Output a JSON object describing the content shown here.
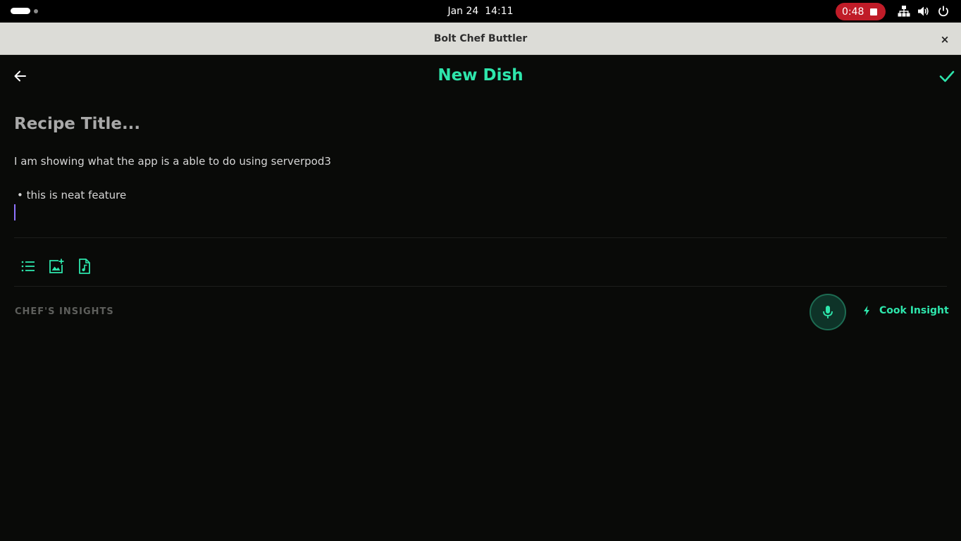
{
  "system_bar": {
    "date": "Jan 24",
    "time": "14:11",
    "recording_time": "0:48"
  },
  "window": {
    "title": "Bolt Chef Buttler",
    "close_glyph": "×"
  },
  "header": {
    "title": "New Dish"
  },
  "editor": {
    "title_placeholder": "Recipe Title...",
    "line1": "I am showing what the app is a able to do using serverpod3",
    "bullet_line": "• this is neat feature"
  },
  "toolbar": {
    "icons": [
      "bulleted-list-icon",
      "add-image-icon",
      "audio-file-icon"
    ]
  },
  "insights": {
    "section_label": "CHEF'S INSIGHTS",
    "cook_insight_label": "Cook Insight"
  },
  "colors": {
    "accent": "#2ee6ac",
    "background": "#090a08",
    "recording": "#c01c28",
    "caret": "#8f73ff"
  }
}
